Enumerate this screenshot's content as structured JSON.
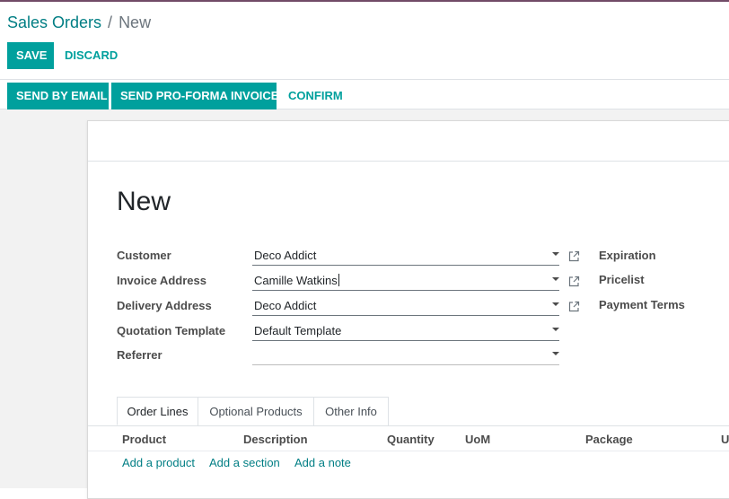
{
  "breadcrumb": {
    "parent": "Sales Orders",
    "separator": "/",
    "current": "New"
  },
  "actions": {
    "save": "SAVE",
    "discard": "DISCARD"
  },
  "statusbar": {
    "send_email": "SEND BY EMAIL",
    "send_proforma": "SEND PRO-FORMA INVOICE",
    "confirm": "CONFIRM"
  },
  "form": {
    "title": "New",
    "fields": [
      {
        "label": "Customer",
        "value": "Deco Addict"
      },
      {
        "label": "Invoice Address",
        "value": "Camille Watkins"
      },
      {
        "label": "Delivery Address",
        "value": "Deco Addict"
      },
      {
        "label": "Quotation Template",
        "value": "Default Template"
      },
      {
        "label": "Referrer",
        "value": ""
      }
    ],
    "right_fields": [
      {
        "label": "Expiration"
      },
      {
        "label": "Pricelist"
      },
      {
        "label": "Payment Terms"
      }
    ]
  },
  "tabs": [
    {
      "label": "Order Lines",
      "active": true
    },
    {
      "label": "Optional Products",
      "active": false
    },
    {
      "label": "Other Info",
      "active": false
    }
  ],
  "table": {
    "columns": [
      "Product",
      "Description",
      "Quantity",
      "UoM",
      "Package",
      "U"
    ],
    "add_links": [
      "Add a product",
      "Add a section",
      "Add a note"
    ]
  },
  "colors": {
    "primary": "#00a09d",
    "link": "#017e84",
    "brand": "#714b67"
  },
  "icons": {
    "external_link": "external-link-icon",
    "dropdown": "caret-down-icon"
  }
}
